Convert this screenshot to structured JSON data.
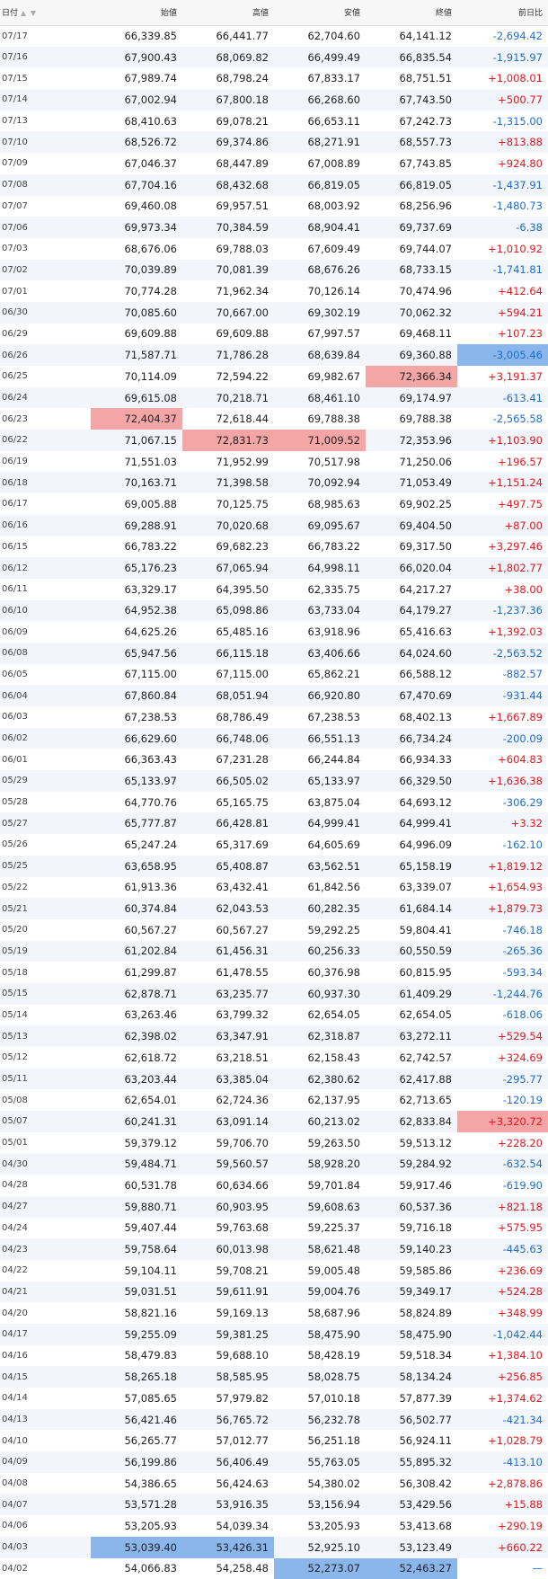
{
  "columns": [
    "日付",
    "始値",
    "高値",
    "安値",
    "終値",
    "前日比"
  ],
  "colors": {
    "positive": "#e8131b",
    "negative": "#1e6cd6",
    "highlight_high": "#f4a5a5",
    "highlight_low": "#8ab6ec"
  },
  "rows": [
    {
      "date": "07/17",
      "open": "66,339.85",
      "high": "66,441.77",
      "low": "62,704.60",
      "close": "64,141.12",
      "change": "-2,694.42"
    },
    {
      "date": "07/16",
      "open": "67,900.43",
      "high": "68,069.82",
      "low": "66,499.49",
      "close": "66,835.54",
      "change": "-1,915.97"
    },
    {
      "date": "07/15",
      "open": "67,989.74",
      "high": "68,798.24",
      "low": "67,833.17",
      "close": "68,751.51",
      "change": "+1,008.01"
    },
    {
      "date": "07/14",
      "open": "67,002.94",
      "high": "67,800.18",
      "low": "66,268.60",
      "close": "67,743.50",
      "change": "+500.77"
    },
    {
      "date": "07/13",
      "open": "68,410.63",
      "high": "69,078.21",
      "low": "66,653.11",
      "close": "67,242.73",
      "change": "-1,315.00"
    },
    {
      "date": "07/10",
      "open": "68,526.72",
      "high": "69,374.86",
      "low": "68,271.91",
      "close": "68,557.73",
      "change": "+813.88"
    },
    {
      "date": "07/09",
      "open": "67,046.37",
      "high": "68,447.89",
      "low": "67,008.89",
      "close": "67,743.85",
      "change": "+924.80"
    },
    {
      "date": "07/08",
      "open": "67,704.16",
      "high": "68,432.68",
      "low": "66,819.05",
      "close": "66,819.05",
      "change": "-1,437.91"
    },
    {
      "date": "07/07",
      "open": "69,460.08",
      "high": "69,957.51",
      "low": "68,003.92",
      "close": "68,256.96",
      "change": "-1,480.73"
    },
    {
      "date": "07/06",
      "open": "69,973.34",
      "high": "70,384.59",
      "low": "68,904.41",
      "close": "69,737.69",
      "change": "-6.38"
    },
    {
      "date": "07/03",
      "open": "68,676.06",
      "high": "69,788.03",
      "low": "67,609.49",
      "close": "69,744.07",
      "change": "+1,010.92"
    },
    {
      "date": "07/02",
      "open": "70,039.89",
      "high": "70,081.39",
      "low": "68,676.26",
      "close": "68,733.15",
      "change": "-1,741.81"
    },
    {
      "date": "07/01",
      "open": "70,774.28",
      "high": "71,962.34",
      "low": "70,126.14",
      "close": "70,474.96",
      "change": "+412.64"
    },
    {
      "date": "06/30",
      "open": "70,085.60",
      "high": "70,667.00",
      "low": "69,302.19",
      "close": "70,062.32",
      "change": "+594.21"
    },
    {
      "date": "06/29",
      "open": "69,609.88",
      "high": "69,609.88",
      "low": "67,997.57",
      "close": "69,468.11",
      "change": "+107.23"
    },
    {
      "date": "06/26",
      "open": "71,587.71",
      "high": "71,786.28",
      "low": "68,639.84",
      "close": "69,360.88",
      "change": "-3,005.46",
      "hl": {
        "change": "blue"
      }
    },
    {
      "date": "06/25",
      "open": "70,114.09",
      "high": "72,594.22",
      "low": "69,982.67",
      "close": "72,366.34",
      "change": "+3,191.37",
      "hl": {
        "close": "red"
      }
    },
    {
      "date": "06/24",
      "open": "69,615.08",
      "high": "70,218.71",
      "low": "68,461.10",
      "close": "69,174.97",
      "change": "-613.41"
    },
    {
      "date": "06/23",
      "open": "72,404.37",
      "high": "72,618.44",
      "low": "69,788.38",
      "close": "69,788.38",
      "change": "-2,565.58",
      "hl": {
        "open": "red"
      }
    },
    {
      "date": "06/22",
      "open": "71,067.15",
      "high": "72,831.73",
      "low": "71,009.52",
      "close": "72,353.96",
      "change": "+1,103.90",
      "hl": {
        "high": "red",
        "low": "red"
      }
    },
    {
      "date": "06/19",
      "open": "71,551.03",
      "high": "71,952.99",
      "low": "70,517.98",
      "close": "71,250.06",
      "change": "+196.57"
    },
    {
      "date": "06/18",
      "open": "70,163.71",
      "high": "71,398.58",
      "low": "70,092.94",
      "close": "71,053.49",
      "change": "+1,151.24"
    },
    {
      "date": "06/17",
      "open": "69,005.88",
      "high": "70,125.75",
      "low": "68,985.63",
      "close": "69,902.25",
      "change": "+497.75"
    },
    {
      "date": "06/16",
      "open": "69,288.91",
      "high": "70,020.68",
      "low": "69,095.67",
      "close": "69,404.50",
      "change": "+87.00"
    },
    {
      "date": "06/15",
      "open": "66,783.22",
      "high": "69,682.23",
      "low": "66,783.22",
      "close": "69,317.50",
      "change": "+3,297.46"
    },
    {
      "date": "06/12",
      "open": "65,176.23",
      "high": "67,065.94",
      "low": "64,998.11",
      "close": "66,020.04",
      "change": "+1,802.77"
    },
    {
      "date": "06/11",
      "open": "63,329.17",
      "high": "64,395.50",
      "low": "62,335.75",
      "close": "64,217.27",
      "change": "+38.00"
    },
    {
      "date": "06/10",
      "open": "64,952.38",
      "high": "65,098.86",
      "low": "63,733.04",
      "close": "64,179.27",
      "change": "-1,237.36"
    },
    {
      "date": "06/09",
      "open": "64,625.26",
      "high": "65,485.16",
      "low": "63,918.96",
      "close": "65,416.63",
      "change": "+1,392.03"
    },
    {
      "date": "06/08",
      "open": "65,947.56",
      "high": "66,115.18",
      "low": "63,406.66",
      "close": "64,024.60",
      "change": "-2,563.52"
    },
    {
      "date": "06/05",
      "open": "67,115.00",
      "high": "67,115.00",
      "low": "65,862.21",
      "close": "66,588.12",
      "change": "-882.57"
    },
    {
      "date": "06/04",
      "open": "67,860.84",
      "high": "68,051.94",
      "low": "66,920.80",
      "close": "67,470.69",
      "change": "-931.44"
    },
    {
      "date": "06/03",
      "open": "67,238.53",
      "high": "68,786.49",
      "low": "67,238.53",
      "close": "68,402.13",
      "change": "+1,667.89"
    },
    {
      "date": "06/02",
      "open": "66,629.60",
      "high": "66,748.06",
      "low": "66,551.13",
      "close": "66,734.24",
      "change": "-200.09"
    },
    {
      "date": "06/01",
      "open": "66,363.43",
      "high": "67,231.28",
      "low": "66,244.84",
      "close": "66,934.33",
      "change": "+604.83"
    },
    {
      "date": "05/29",
      "open": "65,133.97",
      "high": "66,505.02",
      "low": "65,133.97",
      "close": "66,329.50",
      "change": "+1,636.38"
    },
    {
      "date": "05/28",
      "open": "64,770.76",
      "high": "65,165.75",
      "low": "63,875.04",
      "close": "64,693.12",
      "change": "-306.29"
    },
    {
      "date": "05/27",
      "open": "65,777.87",
      "high": "66,428.81",
      "low": "64,999.41",
      "close": "64,999.41",
      "change": "+3.32"
    },
    {
      "date": "05/26",
      "open": "65,247.24",
      "high": "65,317.69",
      "low": "64,605.69",
      "close": "64,996.09",
      "change": "-162.10"
    },
    {
      "date": "05/25",
      "open": "63,658.95",
      "high": "65,408.87",
      "low": "63,562.51",
      "close": "65,158.19",
      "change": "+1,819.12"
    },
    {
      "date": "05/22",
      "open": "61,913.36",
      "high": "63,432.41",
      "low": "61,842.56",
      "close": "63,339.07",
      "change": "+1,654.93"
    },
    {
      "date": "05/21",
      "open": "60,374.84",
      "high": "62,043.53",
      "low": "60,282.35",
      "close": "61,684.14",
      "change": "+1,879.73"
    },
    {
      "date": "05/20",
      "open": "60,567.27",
      "high": "60,567.27",
      "low": "59,292.25",
      "close": "59,804.41",
      "change": "-746.18"
    },
    {
      "date": "05/19",
      "open": "61,202.84",
      "high": "61,456.31",
      "low": "60,256.33",
      "close": "60,550.59",
      "change": "-265.36"
    },
    {
      "date": "05/18",
      "open": "61,299.87",
      "high": "61,478.55",
      "low": "60,376.98",
      "close": "60,815.95",
      "change": "-593.34"
    },
    {
      "date": "05/15",
      "open": "62,878.71",
      "high": "63,235.77",
      "low": "60,937.30",
      "close": "61,409.29",
      "change": "-1,244.76"
    },
    {
      "date": "05/14",
      "open": "63,263.46",
      "high": "63,799.32",
      "low": "62,654.05",
      "close": "62,654.05",
      "change": "-618.06"
    },
    {
      "date": "05/13",
      "open": "62,398.02",
      "high": "63,347.91",
      "low": "62,318.87",
      "close": "63,272.11",
      "change": "+529.54"
    },
    {
      "date": "05/12",
      "open": "62,618.72",
      "high": "63,218.51",
      "low": "62,158.43",
      "close": "62,742.57",
      "change": "+324.69"
    },
    {
      "date": "05/11",
      "open": "63,203.44",
      "high": "63,385.04",
      "low": "62,380.62",
      "close": "62,417.88",
      "change": "-295.77"
    },
    {
      "date": "05/08",
      "open": "62,654.01",
      "high": "62,724.36",
      "low": "62,137.95",
      "close": "62,713.65",
      "change": "-120.19"
    },
    {
      "date": "05/07",
      "open": "60,241.31",
      "high": "63,091.14",
      "low": "60,213.02",
      "close": "62,833.84",
      "change": "+3,320.72",
      "hl": {
        "change": "red"
      }
    },
    {
      "date": "05/01",
      "open": "59,379.12",
      "high": "59,706.70",
      "low": "59,263.50",
      "close": "59,513.12",
      "change": "+228.20"
    },
    {
      "date": "04/30",
      "open": "59,484.71",
      "high": "59,560.57",
      "low": "58,928.20",
      "close": "59,284.92",
      "change": "-632.54"
    },
    {
      "date": "04/28",
      "open": "60,531.78",
      "high": "60,634.66",
      "low": "59,701.84",
      "close": "59,917.46",
      "change": "-619.90"
    },
    {
      "date": "04/27",
      "open": "59,880.71",
      "high": "60,903.95",
      "low": "59,608.63",
      "close": "60,537.36",
      "change": "+821.18"
    },
    {
      "date": "04/24",
      "open": "59,407.44",
      "high": "59,763.68",
      "low": "59,225.37",
      "close": "59,716.18",
      "change": "+575.95"
    },
    {
      "date": "04/23",
      "open": "59,758.64",
      "high": "60,013.98",
      "low": "58,621.48",
      "close": "59,140.23",
      "change": "-445.63"
    },
    {
      "date": "04/22",
      "open": "59,104.11",
      "high": "59,708.21",
      "low": "59,005.48",
      "close": "59,585.86",
      "change": "+236.69"
    },
    {
      "date": "04/21",
      "open": "59,031.51",
      "high": "59,611.91",
      "low": "59,004.76",
      "close": "59,349.17",
      "change": "+524.28"
    },
    {
      "date": "04/20",
      "open": "58,821.16",
      "high": "59,169.13",
      "low": "58,687.96",
      "close": "58,824.89",
      "change": "+348.99"
    },
    {
      "date": "04/17",
      "open": "59,255.09",
      "high": "59,381.25",
      "low": "58,475.90",
      "close": "58,475.90",
      "change": "-1,042.44"
    },
    {
      "date": "04/16",
      "open": "58,479.83",
      "high": "59,688.10",
      "low": "58,428.19",
      "close": "59,518.34",
      "change": "+1,384.10"
    },
    {
      "date": "04/15",
      "open": "58,265.18",
      "high": "58,585.95",
      "low": "58,028.75",
      "close": "58,134.24",
      "change": "+256.85"
    },
    {
      "date": "04/14",
      "open": "57,085.65",
      "high": "57,979.82",
      "low": "57,010.18",
      "close": "57,877.39",
      "change": "+1,374.62"
    },
    {
      "date": "04/13",
      "open": "56,421.46",
      "high": "56,765.72",
      "low": "56,232.78",
      "close": "56,502.77",
      "change": "-421.34"
    },
    {
      "date": "04/10",
      "open": "56,265.77",
      "high": "57,012.77",
      "low": "56,251.18",
      "close": "56,924.11",
      "change": "+1,028.79"
    },
    {
      "date": "04/09",
      "open": "56,199.86",
      "high": "56,406.49",
      "low": "55,763.05",
      "close": "55,895.32",
      "change": "-413.10"
    },
    {
      "date": "04/08",
      "open": "54,386.65",
      "high": "56,424.63",
      "low": "54,380.02",
      "close": "56,308.42",
      "change": "+2,878.86"
    },
    {
      "date": "04/07",
      "open": "53,571.28",
      "high": "53,916.35",
      "low": "53,156.94",
      "close": "53,429.56",
      "change": "+15.88"
    },
    {
      "date": "04/06",
      "open": "53,205.93",
      "high": "54,039.34",
      "low": "53,205.93",
      "close": "53,413.68",
      "change": "+290.19"
    },
    {
      "date": "04/03",
      "open": "53,039.40",
      "high": "53,426.31",
      "low": "52,925.10",
      "close": "53,123.49",
      "change": "+660.22",
      "hl": {
        "open": "blue",
        "high": "blue"
      }
    },
    {
      "date": "04/02",
      "open": "54,066.83",
      "high": "54,258.48",
      "low": "52,273.07",
      "close": "52,463.27",
      "change": "—",
      "hl": {
        "low": "blue",
        "close": "blue"
      }
    }
  ]
}
